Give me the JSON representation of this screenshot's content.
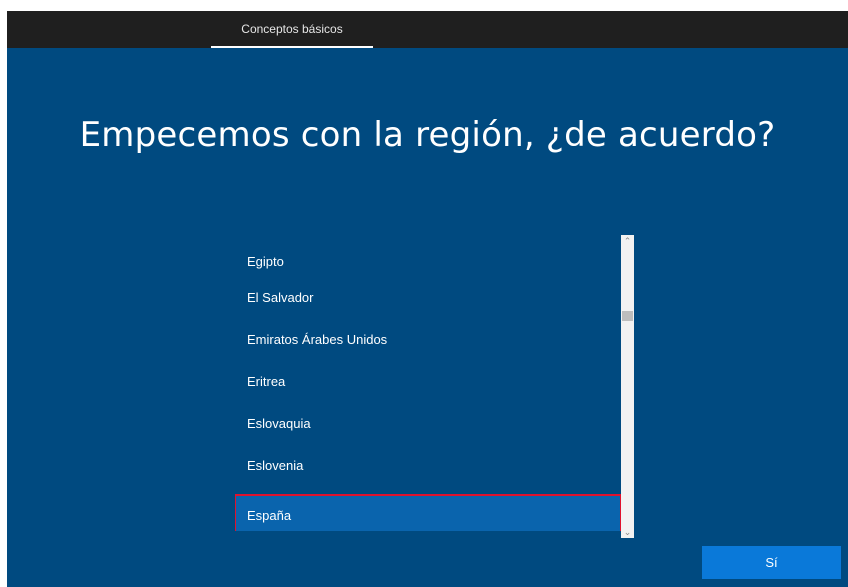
{
  "header": {
    "tab_label": "Conceptos básicos"
  },
  "page": {
    "title": "Empecemos con la región, ¿de acuerdo?"
  },
  "region_list": {
    "items": [
      "Egipto",
      "El Salvador",
      "Emiratos Árabes Unidos",
      "Eritrea",
      "Eslovaquia",
      "Eslovenia",
      "España"
    ],
    "selected": "España"
  },
  "scrollbar": {
    "up_icon": "chevron-up-icon",
    "down_icon": "chevron-down-icon"
  },
  "footer": {
    "yes_label": "Sí"
  },
  "colors": {
    "background": "#004a80",
    "topbar": "#1f1f1f",
    "selected_item": "#0a64ad",
    "selection_outline": "#e0122d",
    "button": "#0a79d9"
  }
}
